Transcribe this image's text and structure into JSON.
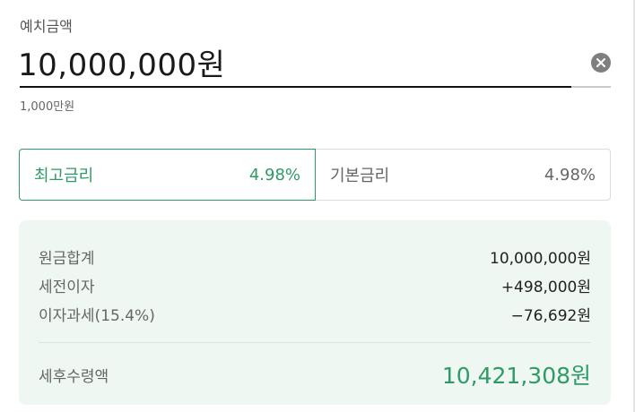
{
  "deposit": {
    "label": "예치금액",
    "value": "10,000,000원",
    "helper": "1,000만원"
  },
  "rate_tabs": [
    {
      "label": "최고금리",
      "rate": "4.98%",
      "selected": true
    },
    {
      "label": "기본금리",
      "rate": "4.98%",
      "selected": false
    }
  ],
  "summary": {
    "principal": {
      "label": "원금합계",
      "value": "10,000,000원"
    },
    "pretax_interest": {
      "label": "세전이자",
      "value": "+498,000원"
    },
    "tax": {
      "label": "이자과세(15.4%)",
      "value": "−76,692원"
    },
    "total": {
      "label": "세후수령액",
      "value": "10,421,308원"
    }
  },
  "colors": {
    "accent": "#2e9b66",
    "summary_bg": "#eef7f1",
    "clear_button": "#7f7f7f"
  },
  "icons": {
    "clear": "close-icon"
  }
}
